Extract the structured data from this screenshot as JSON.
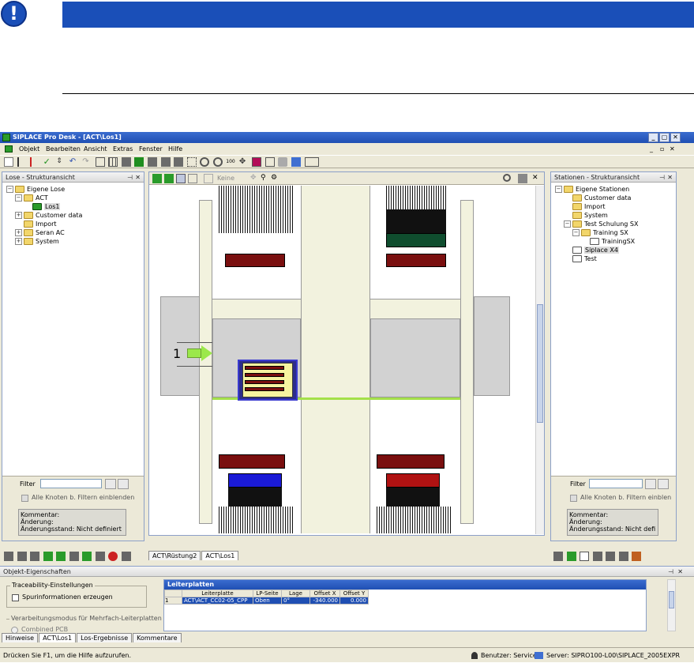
{
  "doc_header": {
    "accent": "#1a4fb8",
    "notice_icon": "exclamation-icon"
  },
  "window": {
    "title": "SIPLACE Pro Desk - [ACT\\Los1]",
    "controls": [
      "_",
      "▢",
      "✕"
    ]
  },
  "menu": [
    "Objekt",
    "Bearbeiten",
    "Ansicht",
    "Extras",
    "Fenster",
    "Hilfe"
  ],
  "left_panel": {
    "title": "Lose - Strukturansicht",
    "tree": [
      {
        "label": "Eigene Lose",
        "level": 0,
        "toggle": "-"
      },
      {
        "label": "ACT",
        "level": 1,
        "toggle": "-"
      },
      {
        "label": "Los1",
        "level": 2,
        "toggle": "",
        "selected": true
      },
      {
        "label": "Customer data",
        "level": 1,
        "toggle": "+"
      },
      {
        "label": "Import",
        "level": 1,
        "toggle": ""
      },
      {
        "label": "Seran AC",
        "level": 1,
        "toggle": "+"
      },
      {
        "label": "System",
        "level": 1,
        "toggle": "+"
      }
    ],
    "filter_label": "Filter",
    "checkbox_label": "Alle Knoten b. Filtern einblenden",
    "comment": [
      "Kommentar:",
      "Änderung:",
      "Änderungsstand: Nicht definiert"
    ]
  },
  "right_panel": {
    "title": "Stationen - Strukturansicht",
    "tree": [
      {
        "label": "Eigene Stationen",
        "level": 0,
        "toggle": "-"
      },
      {
        "label": "Customer data",
        "level": 1,
        "toggle": ""
      },
      {
        "label": "Import",
        "level": 1,
        "toggle": ""
      },
      {
        "label": "System",
        "level": 1,
        "toggle": ""
      },
      {
        "label": "Test Schulung SX",
        "level": 1,
        "toggle": "-"
      },
      {
        "label": "Training SX",
        "level": 2,
        "toggle": "-"
      },
      {
        "label": "TrainingSX",
        "level": 3,
        "toggle": ""
      },
      {
        "label": "Siplace X4",
        "level": 1,
        "toggle": "",
        "selected": true
      },
      {
        "label": "Test",
        "level": 1,
        "toggle": ""
      }
    ],
    "filter_label": "Filter",
    "checkbox_label": "Alle Knoten b. Filtern einblen",
    "comment": [
      "Kommentar:",
      "Änderung:",
      "Änderungsstand: Nicht definiert"
    ]
  },
  "center": {
    "toolbar_combo": "Keine",
    "callout_number": "1",
    "doc_tabs": [
      "ACT\\Rüstung2",
      "ACT\\Los1"
    ]
  },
  "props": {
    "title": "Objekt-Eigenschaften",
    "group1": "Traceability-Einstellungen",
    "check1": "Spurinformationen erzeugen",
    "group2": "Verarbeitungsmodus für Mehrfach-Leiterplatten",
    "radio1": "Combined PCB",
    "grid_title": "Leiterplatten",
    "columns": [
      "Leiterplatte",
      "LP-Seite",
      "Lage",
      "Offset X",
      "Offset Y"
    ],
    "row": {
      "num": "1",
      "leiterplatte": "ACT\\ACT_CC02-05_CPP",
      "lp_seite": "Oben",
      "lage": "0°",
      "offset_x": "-340.000",
      "offset_y": "0.000"
    }
  },
  "bottom_tabs": [
    "Hinweise",
    "ACT\\Los1",
    "Los-Ergebnisse",
    "Kommentare"
  ],
  "status": {
    "help": "Drücken Sie F1, um die Hilfe aufzurufen.",
    "user": "Benutzer: Service",
    "server": "Server: SIPRO100-L00\\SIPLACE_2005EXPR"
  }
}
